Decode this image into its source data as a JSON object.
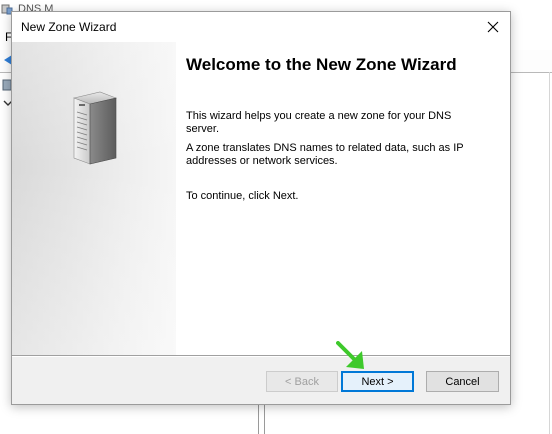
{
  "background_window": {
    "title_partial": "DNS M",
    "menu_letter": "F"
  },
  "dialog": {
    "title": "New Zone Wizard",
    "close_glyph": "✕",
    "heading": "Welcome to the New Zone Wizard",
    "paragraphs": [
      "This wizard helps you create a new zone for your DNS server.",
      "A zone translates DNS names to related data, such as IP addresses or network services.",
      "To continue, click Next."
    ],
    "buttons": {
      "back": {
        "label": "< Back",
        "enabled": false
      },
      "next": {
        "label": "Next >",
        "enabled": true,
        "focused": true
      },
      "cancel": {
        "label": "Cancel",
        "enabled": true
      }
    }
  },
  "colors": {
    "focus_border": "#0078d7",
    "pointer_arrow": "#3ec92b",
    "dialog_face": "#f0f0f0"
  },
  "icons": {
    "server": "server-icon",
    "pointer": "green-pointer-arrow-icon",
    "close": "close-icon",
    "back_arrow": "back-arrow-icon",
    "tree_chevron": "chevron-down-icon"
  }
}
